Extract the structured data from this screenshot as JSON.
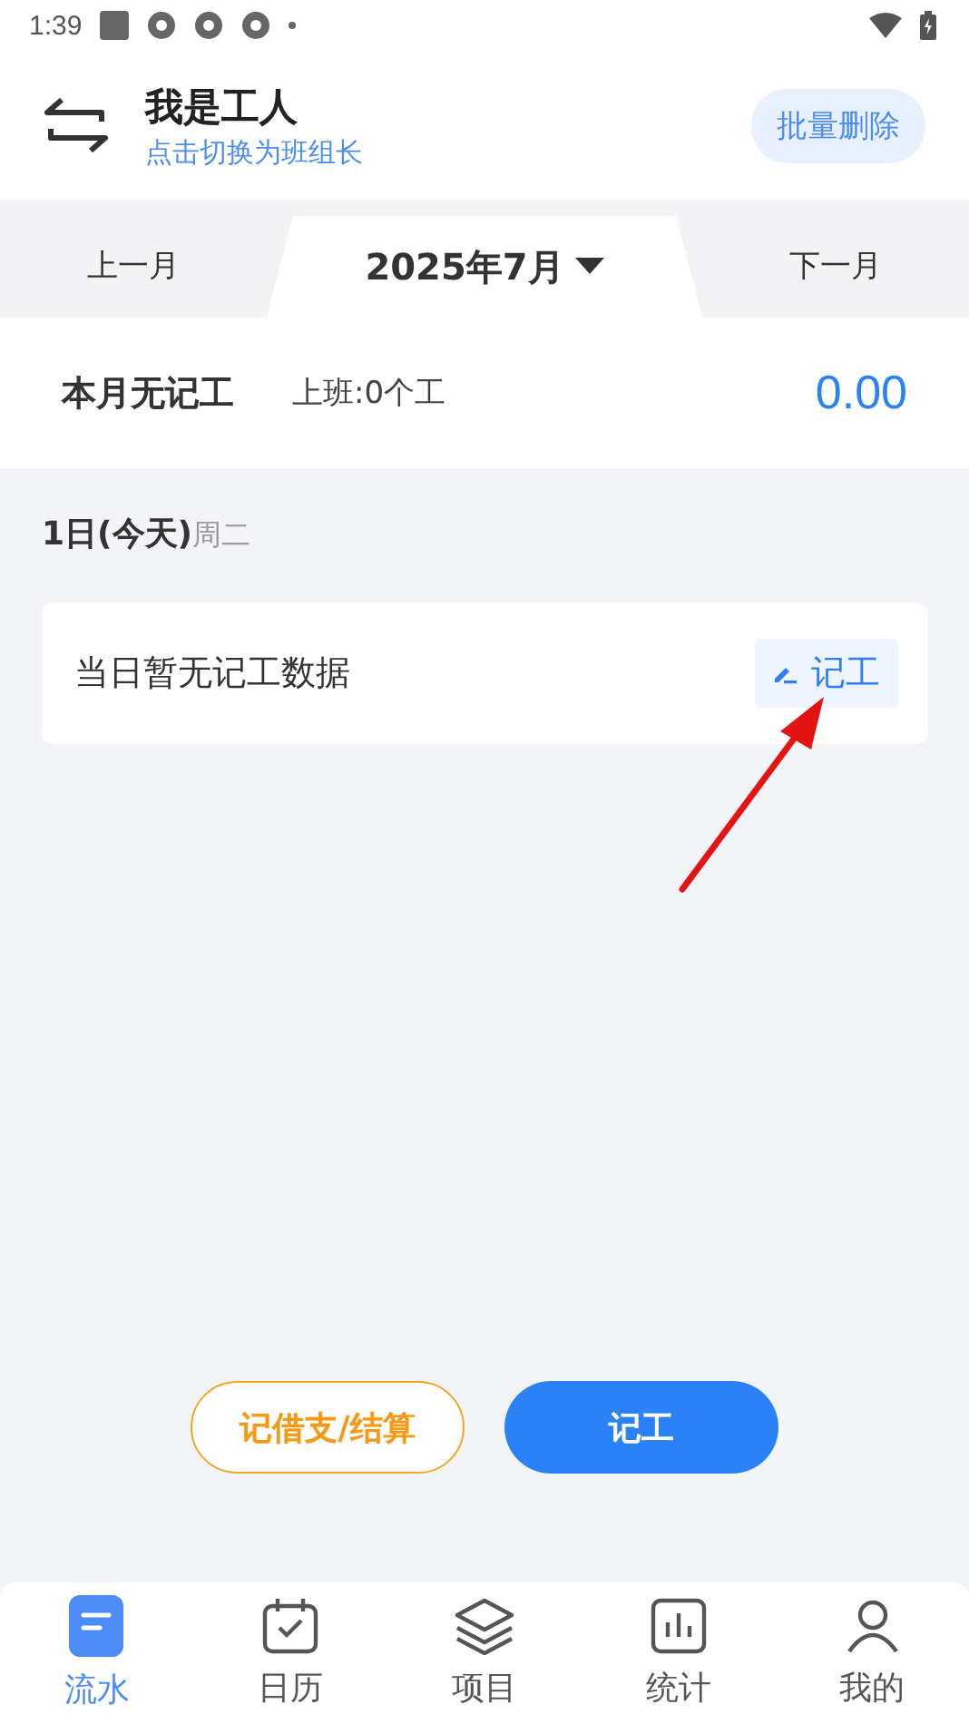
{
  "status_bar": {
    "time": "1:39"
  },
  "header": {
    "title": "我是工人",
    "subtitle": "点击切换为班组长",
    "action": "批量删除"
  },
  "month_nav": {
    "prev": "上一月",
    "current": "2025年7月",
    "next": "下一月"
  },
  "summary": {
    "label": "本月无记工",
    "attendance": "上班:0个工",
    "amount": "0.00"
  },
  "day": {
    "date": "1日(今天)",
    "weekday": "周二",
    "empty_text": "当日暂无记工数据",
    "action": "记工"
  },
  "actions": [
    {
      "label": "记借支/结算",
      "kind": "outline"
    },
    {
      "label": "记工",
      "kind": "primary"
    }
  ],
  "tabs": [
    {
      "label": "流水",
      "selected": true
    },
    {
      "label": "日历",
      "selected": false
    },
    {
      "label": "项目",
      "selected": false
    },
    {
      "label": "统计",
      "selected": false
    },
    {
      "label": "我的",
      "selected": false
    }
  ]
}
